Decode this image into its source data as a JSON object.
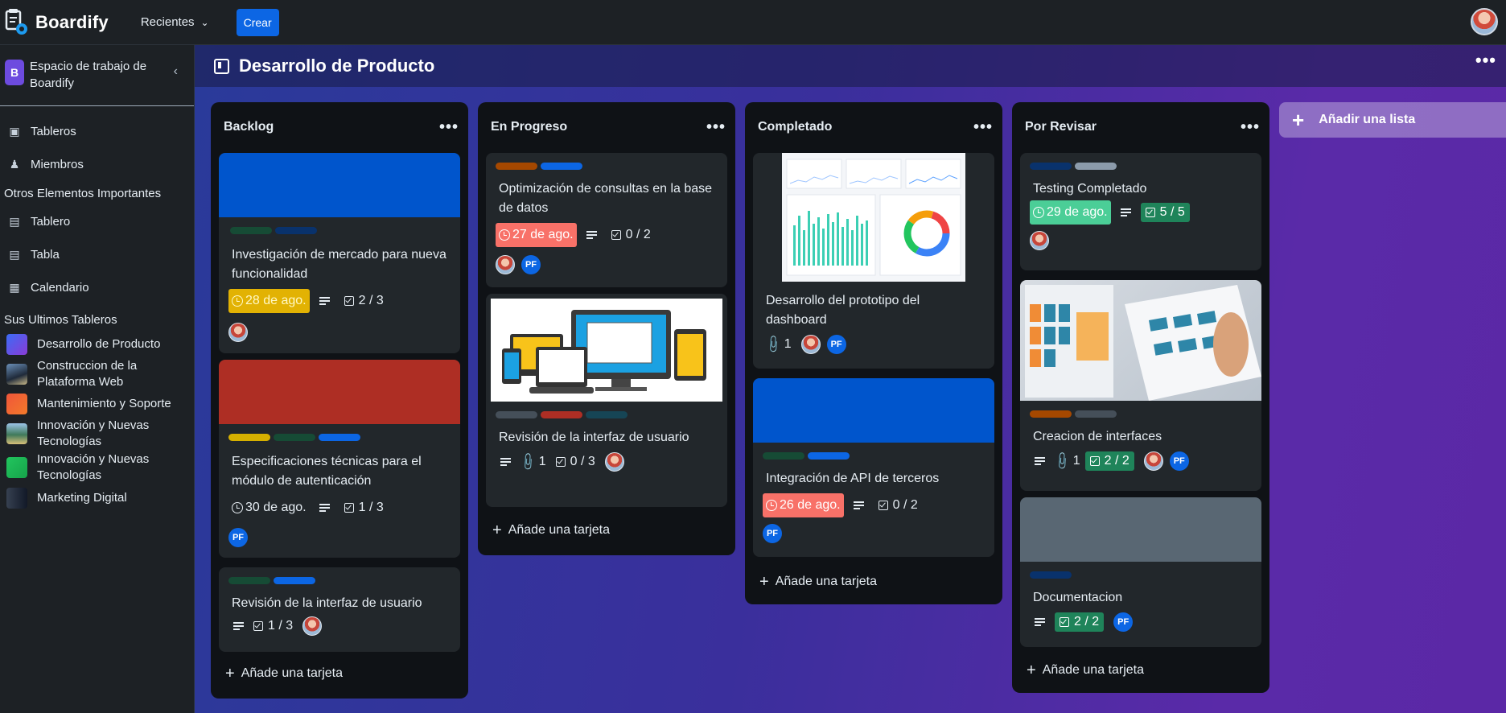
{
  "app": {
    "name": "Boardify"
  },
  "topbar": {
    "recent_label": "Recientes",
    "create_label": "Crear"
  },
  "sidebar": {
    "workspace_initial": "B",
    "workspace_name": "Espacio de trabajo de Boardify",
    "nav": [
      {
        "label": "Tableros",
        "icon": "board-icon"
      },
      {
        "label": "Miembros",
        "icon": "members-icon"
      }
    ],
    "other_heading": "Otros Elementos Importantes",
    "other": [
      {
        "label": "Tablero",
        "icon": "clipboard-icon"
      },
      {
        "label": "Tabla",
        "icon": "table-icon"
      },
      {
        "label": "Calendario",
        "icon": "calendar-icon"
      }
    ],
    "recent_heading": "Sus Ultimos Tableros",
    "recent_boards": [
      {
        "label": "Desarrollo de Producto",
        "color": "#5b4cf5"
      },
      {
        "label": "Construccion de la Plataforma Web",
        "color": "#3b4a6b"
      },
      {
        "label": "Mantenimiento y Soporte",
        "color": "#f0553a"
      },
      {
        "label": "Innovación y Nuevas Tecnologías",
        "color": "#3f7a5a"
      },
      {
        "label": "Innovación y Nuevas Tecnologías",
        "color": "#22c55e"
      },
      {
        "label": "Marketing Digital",
        "color": "#1f2937"
      }
    ]
  },
  "board": {
    "title": "Desarrollo de Producto"
  },
  "add_list_label": "Añadir una lista",
  "add_card_label": "Añade una tarjeta",
  "lists": [
    {
      "title": "Backlog",
      "cards": [
        {
          "title": "Investigación de mercado para nueva funcionalidad",
          "date": "28 de ago.",
          "checklist": "2 / 3"
        },
        {
          "title": "Especificaciones técnicas para el módulo de autenticación",
          "date": "30 de ago.",
          "checklist": "1 / 3",
          "member": "PF"
        },
        {
          "title": "Revisión de la interfaz de usuario",
          "checklist": "1 / 3"
        }
      ]
    },
    {
      "title": "En Progreso",
      "cards": [
        {
          "title": "Optimización de consultas en la base de datos",
          "date": "27 de ago.",
          "checklist": "0 / 2",
          "member": "PF"
        },
        {
          "title": "Revisión de la interfaz de usuario",
          "attachments": "1",
          "checklist": "0 / 3"
        }
      ]
    },
    {
      "title": "Completado",
      "cards": [
        {
          "title": "Desarrollo del prototipo del dashboard",
          "attachments": "1",
          "member": "PF"
        },
        {
          "title": "Integración de API de terceros",
          "date": "26 de ago.",
          "checklist": "0 / 2",
          "member": "PF"
        }
      ]
    },
    {
      "title": "Por Revisar",
      "cards": [
        {
          "title": "Testing Completado",
          "date": "29 de ago.",
          "checklist": "5 / 5"
        },
        {
          "title": "Creacion de interfaces",
          "attachments": "1",
          "checklist": "2 / 2",
          "member": "PF"
        },
        {
          "title": "Documentacion",
          "checklist": "2 / 2",
          "member": "PF"
        }
      ]
    }
  ],
  "colors": {
    "accent": "#0c66e4",
    "date_due_soon": "#e2b203",
    "date_overdue": "#f87168",
    "date_done": "#4bce97",
    "checklist_done": "#1f845a"
  }
}
